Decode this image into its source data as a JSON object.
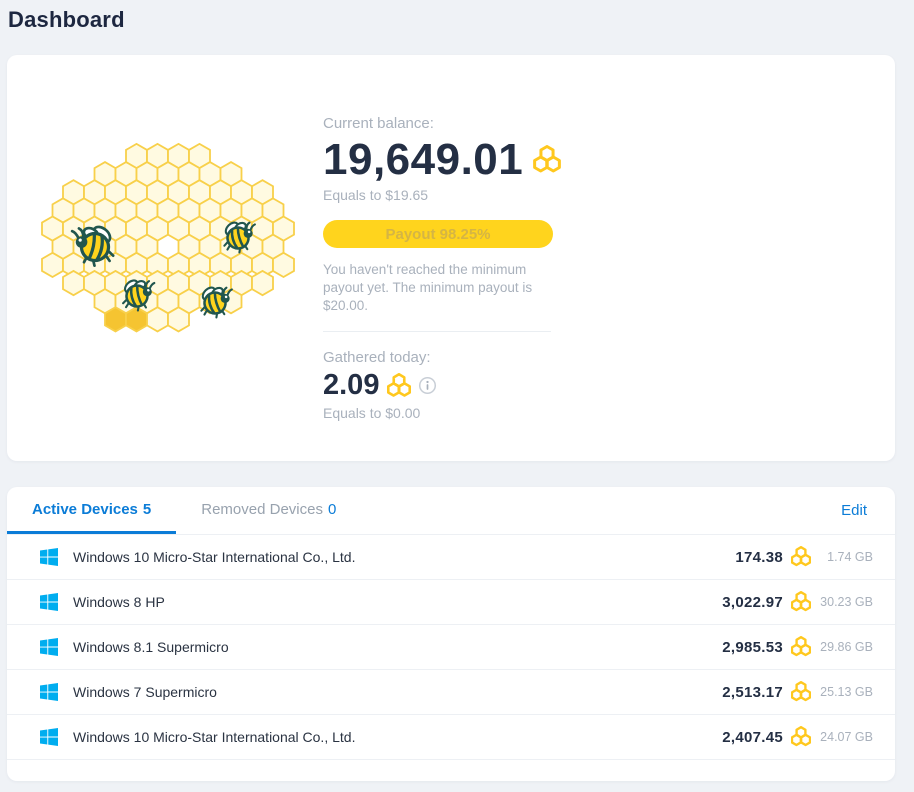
{
  "page": {
    "title": "Dashboard"
  },
  "balance": {
    "label": "Current balance:",
    "amount": "19,649.01",
    "equals": "Equals to $19.65",
    "payout_button": "Payout 98.25%",
    "payout_note": "You haven't reached the minimum payout yet. The minimum payout is $20.00.",
    "gathered_label": "Gathered today:",
    "gathered_amount": "2.09",
    "gathered_equals": "Equals to $0.00"
  },
  "tabs": {
    "active": {
      "label": "Active Devices",
      "count": "5"
    },
    "removed": {
      "label": "Removed Devices",
      "count": "0"
    },
    "edit_label": "Edit"
  },
  "devices": [
    {
      "os": "windows",
      "name": "Windows 10 Micro-Star International Co., Ltd.",
      "credits": "174.38",
      "traffic": "1.74 GB"
    },
    {
      "os": "windows",
      "name": "Windows 8 HP",
      "credits": "3,022.97",
      "traffic": "30.23 GB"
    },
    {
      "os": "windows",
      "name": "Windows 8.1 Supermicro",
      "credits": "2,985.53",
      "traffic": "29.86 GB"
    },
    {
      "os": "windows",
      "name": "Windows 7 Supermicro",
      "credits": "2,513.17",
      "traffic": "25.13 GB"
    },
    {
      "os": "windows",
      "name": "Windows 10 Micro-Star International Co., Ltd.",
      "credits": "2,407.45",
      "traffic": "24.07 GB"
    }
  ],
  "icons": {
    "currency": "honeycomb-icon",
    "device_os": "windows-icon",
    "gathered_hint": "info-icon",
    "illustration": "honeycomb-hive-with-bees"
  },
  "colors": {
    "accent_yellow": "#FFD41D",
    "payout_text": "#D5B544",
    "link_blue": "#0B7CD7",
    "windows_blue": "#00ADEF",
    "navy_text": "#242F44",
    "muted_text": "#A9B1BC",
    "hive_stroke": "#F8D04A",
    "hive_fill": "#FFFAE1",
    "bee_teal": "#21564E",
    "page_background": "#EFF2F6"
  }
}
